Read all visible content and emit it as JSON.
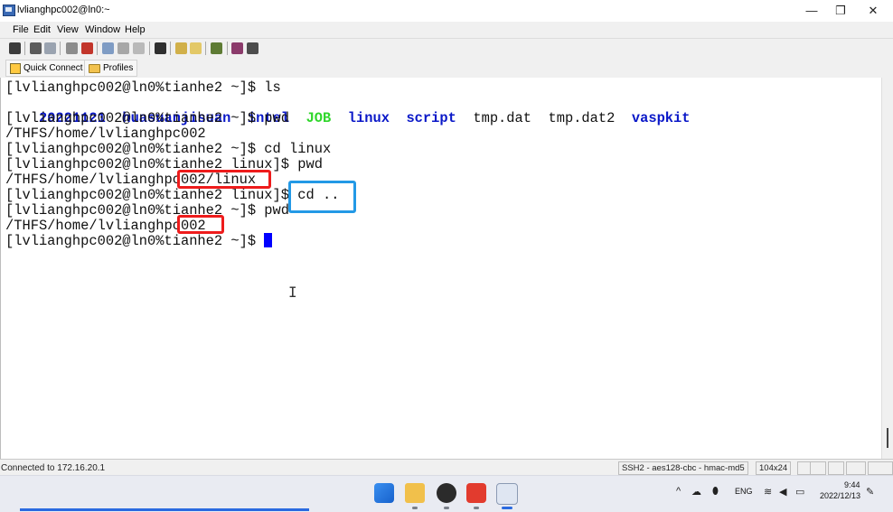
{
  "window": {
    "title": "lvlianghpc002@ln0:~",
    "min_symbol": "—",
    "max_symbol": "❐",
    "close_symbol": "✕"
  },
  "menu": [
    "File",
    "Edit",
    "View",
    "Window",
    "Help"
  ],
  "tabs": {
    "quick_connect": "Quick Connect",
    "profiles": "Profiles"
  },
  "terminal": {
    "prompt_home": "[lvlianghpc002@ln0%tianhe2 ~]$ ",
    "prompt_linux": "[lvlianghpc002@ln0%tianhe2 linux]$ ",
    "lines": [
      "[lvlianghpc002@ln0%tianhe2 ~]$ ls",
      "",
      "[lvlianghpc002@ln0%tianhe2 ~]$ pwd",
      "/THFS/home/lvlianghpc002",
      "[lvlianghpc002@ln0%tianhe2 ~]$ cd linux",
      "[lvlianghpc002@ln0%tianhe2 linux]$ pwd",
      "/THFS/home/lvlianghpc002/linux",
      "[lvlianghpc002@ln0%tianhe2 linux]$ cd ..",
      "[lvlianghpc002@ln0%tianhe2 ~]$ pwd",
      "/THFS/home/lvlianghpc002",
      "[lvlianghpc002@ln0%tianhe2 ~]$ "
    ],
    "ls_items": [
      {
        "name": "20221121",
        "kind": "dir"
      },
      {
        "name": "huasuanjisuan",
        "kind": "dir"
      },
      {
        "name": "intel",
        "kind": "dir"
      },
      {
        "name": "JOB",
        "kind": "exe"
      },
      {
        "name": "linux",
        "kind": "dir"
      },
      {
        "name": "script",
        "kind": "dir"
      },
      {
        "name": "tmp.dat",
        "kind": "file"
      },
      {
        "name": "tmp.dat2",
        "kind": "file"
      },
      {
        "name": "vaspkit",
        "kind": "dir"
      }
    ],
    "colors": {
      "dir": "#0a18c8",
      "exe": "#2fd62b",
      "file": "#111111",
      "cursor": "#0000ff",
      "highlight_red": "#ee1c1c",
      "highlight_blue": "#2399e6"
    }
  },
  "status": {
    "connection": "Connected to 172.16.20.1",
    "cipher": "SSH2 - aes128-cbc - hmac-md5",
    "size": "104x24"
  },
  "taskbar": {
    "language": "ENG",
    "time": "9:44",
    "date": "2022/12/13"
  }
}
